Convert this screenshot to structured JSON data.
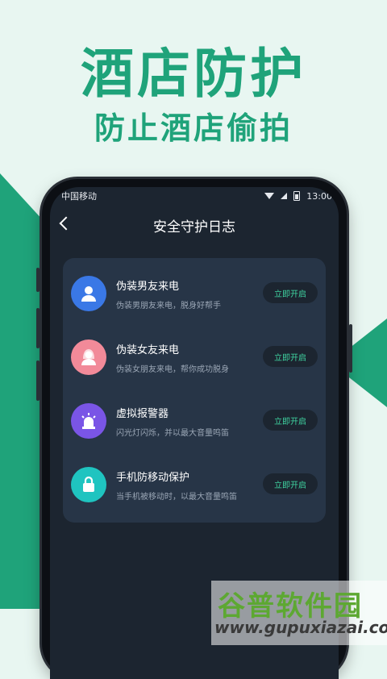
{
  "hero": {
    "title": "酒店防护",
    "subtitle": "防止酒店偷拍"
  },
  "status_bar": {
    "carrier": "中国移动",
    "time": "13:00"
  },
  "nav": {
    "title": "安全守护日志"
  },
  "items": [
    {
      "title": "伪装男友来电",
      "desc": "伪装男朋友来电，脱身好帮手",
      "button": "立即开启",
      "icon": "male-avatar-icon",
      "color": "#3a78e6"
    },
    {
      "title": "伪装女友来电",
      "desc": "伪装女朋友来电，帮你成功脱身",
      "button": "立即开启",
      "icon": "female-avatar-icon",
      "color": "#f28a99"
    },
    {
      "title": "虚拟报警器",
      "desc": "闪光灯闪烁，并以最大音量鸣笛",
      "button": "立即开启",
      "icon": "alarm-siren-icon",
      "color": "#7a55e6"
    },
    {
      "title": "手机防移动保护",
      "desc": "当手机被移动时，以最大音量鸣笛",
      "button": "立即开启",
      "icon": "lock-icon",
      "color": "#1fc4c0"
    }
  ],
  "watermark": {
    "cn": "谷普软件园",
    "en": "www.gupuxiazai.com"
  },
  "colors": {
    "accent": "#1fa37a",
    "button_text": "#3fd3a0",
    "card_bg": "#273547",
    "screen_bg": "#1c2530"
  }
}
